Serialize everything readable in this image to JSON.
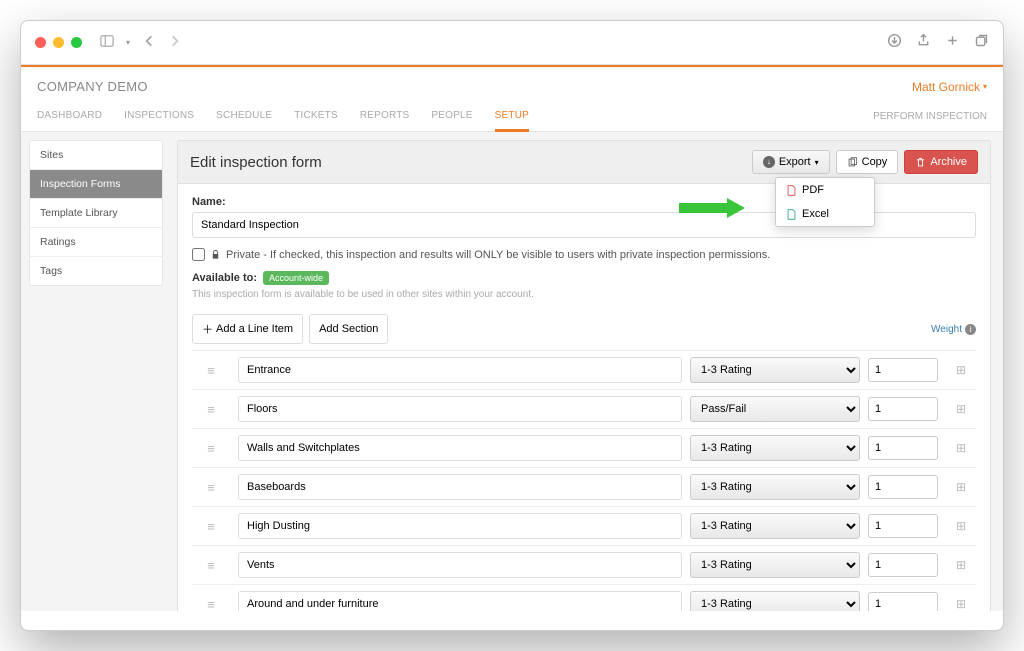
{
  "chrome": {
    "company": "COMPANY DEMO",
    "user": "Matt Gornick"
  },
  "tabs": {
    "items": [
      "DASHBOARD",
      "INSPECTIONS",
      "SCHEDULE",
      "TICKETS",
      "REPORTS",
      "PEOPLE",
      "SETUP"
    ],
    "active": "SETUP",
    "right": "PERFORM INSPECTION"
  },
  "sidebar": {
    "items": [
      "Sites",
      "Inspection Forms",
      "Template Library",
      "Ratings",
      "Tags"
    ],
    "active": "Inspection Forms"
  },
  "panel": {
    "title": "Edit inspection form",
    "export_label": "Export",
    "copy_label": "Copy",
    "archive_label": "Archive",
    "dropdown": {
      "pdf": "PDF",
      "excel": "Excel"
    }
  },
  "form": {
    "name_label": "Name:",
    "name_value": "Standard Inspection",
    "private_label": "Private - If checked, this inspection and results will ONLY be visible to users with private inspection permissions.",
    "available_label": "Available to:",
    "available_badge": "Account-wide",
    "helper": "This inspection form is available to be used in other sites within your account.",
    "add_line_item": "Add a Line Item",
    "add_section": "Add Section",
    "weight_label": "Weight"
  },
  "line_items": [
    {
      "name": "Entrance",
      "rating": "1-3 Rating",
      "weight": "1"
    },
    {
      "name": "Floors",
      "rating": "Pass/Fail",
      "weight": "1"
    },
    {
      "name": "Walls and Switchplates",
      "rating": "1-3 Rating",
      "weight": "1"
    },
    {
      "name": "Baseboards",
      "rating": "1-3 Rating",
      "weight": "1"
    },
    {
      "name": "High Dusting",
      "rating": "1-3 Rating",
      "weight": "1"
    },
    {
      "name": "Vents",
      "rating": "1-3 Rating",
      "weight": "1"
    },
    {
      "name": "Around and under furniture",
      "rating": "1-3 Rating",
      "weight": "1"
    }
  ]
}
